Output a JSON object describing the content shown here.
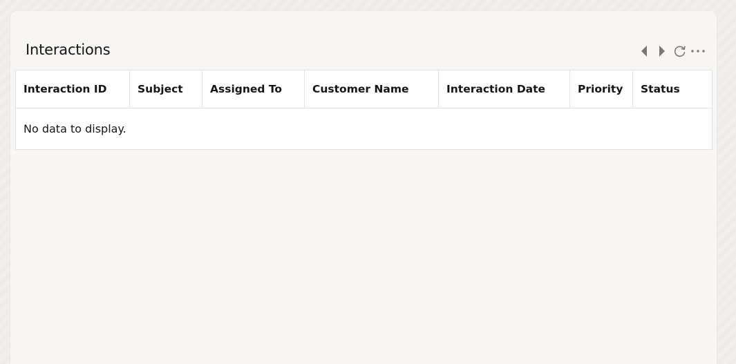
{
  "card": {
    "title": "Interactions"
  },
  "toolbar": {
    "previous": "previous-icon",
    "next": "next-icon",
    "refresh": "refresh-icon",
    "more": "more-options-icon",
    "icon_color": "#7a7773"
  },
  "table": {
    "columns": [
      "Interaction ID",
      "Subject",
      "Assigned To",
      "Customer Name",
      "Interaction Date",
      "Priority",
      "Status"
    ],
    "rows": [],
    "empty_message": "No data to display."
  }
}
